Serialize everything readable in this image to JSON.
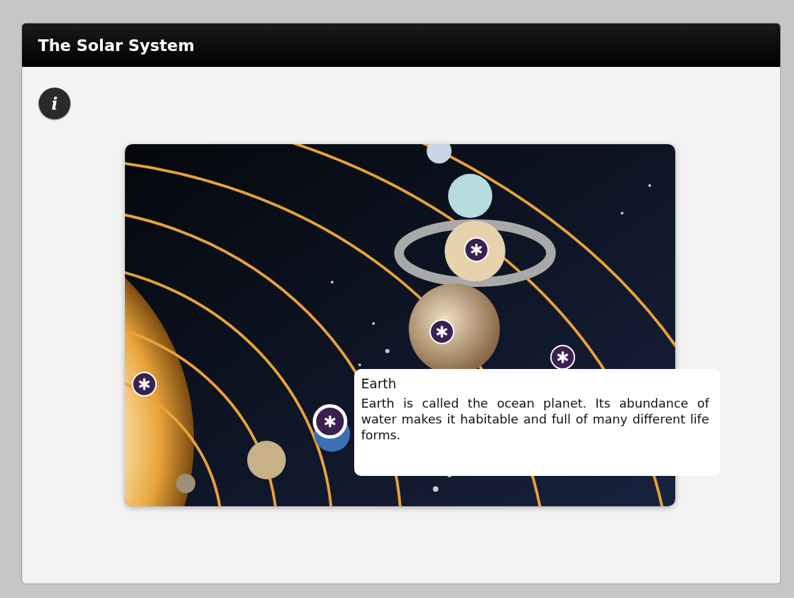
{
  "window": {
    "title": "The Solar System"
  },
  "info_button": {
    "label": "i"
  },
  "hotspots": [
    {
      "selected": false
    },
    {
      "selected": false
    },
    {
      "selected": false
    },
    {
      "selected": false
    },
    {
      "selected": true
    }
  ],
  "tooltip": {
    "title": "Earth",
    "text": "Earth is called the ocean planet. Its abundance of water makes it habitable and full of many different life forms."
  }
}
